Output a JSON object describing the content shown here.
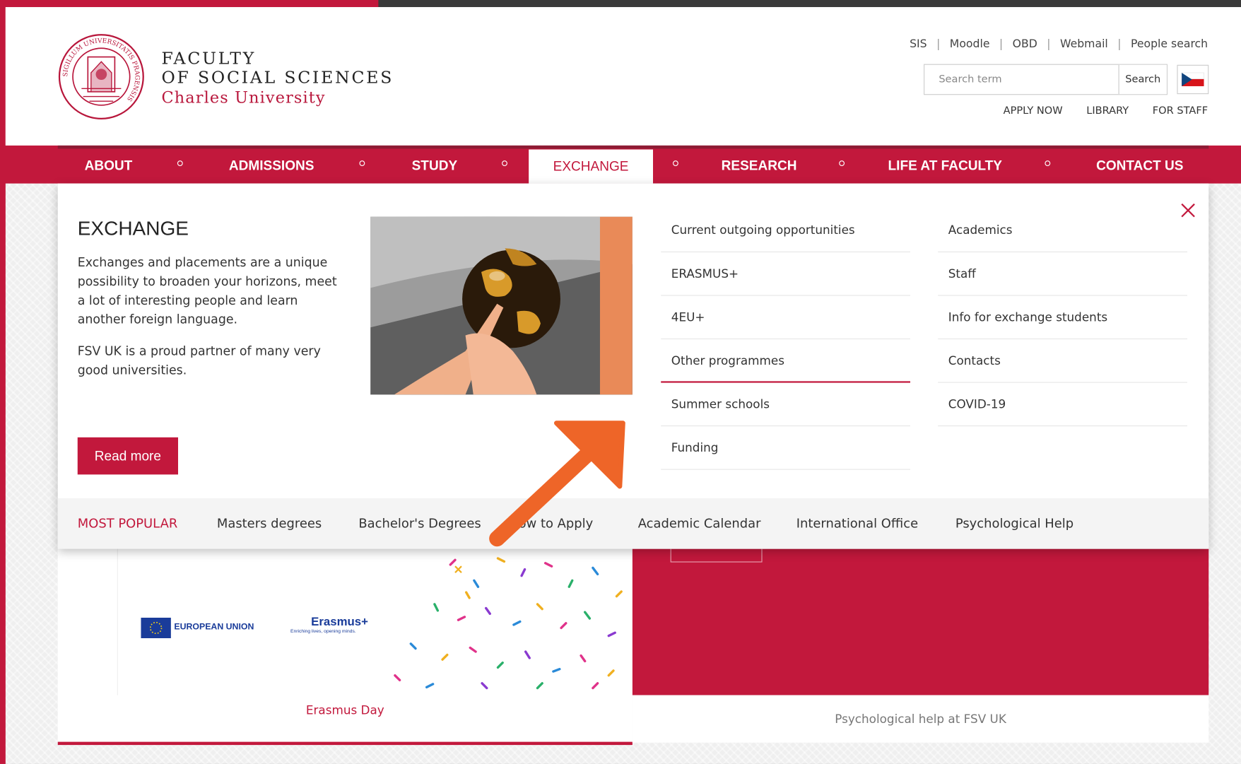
{
  "header": {
    "logo": {
      "line1": "FACULTY",
      "line2": "OF SOCIAL SCIENCES",
      "line3": "Charles University",
      "seal_text": "SIGILLUM UNIVERSITATIS PRAGENSIS"
    },
    "top_links": [
      "SIS",
      "Moodle",
      "OBD",
      "Webmail",
      "People search"
    ],
    "search": {
      "placeholder": "Search term",
      "button_label": "Search"
    },
    "language_icon": "czech-flag-icon",
    "quick_links": [
      "APPLY NOW",
      "LIBRARY",
      "FOR STAFF"
    ]
  },
  "nav": {
    "items": [
      "ABOUT",
      "ADMISSIONS",
      "STUDY",
      "EXCHANGE",
      "RESEARCH",
      "LIFE AT FACULTY",
      "CONTACT US"
    ],
    "active": "EXCHANGE"
  },
  "dropdown": {
    "title": "EXCHANGE",
    "paragraph1": "Exchanges and placements are a unique possibility to broaden your horizons, meet a lot of interesting people and learn another foreign language.",
    "paragraph2": "FSV UK is a proud partner of many very good universities.",
    "read_more": "Read more",
    "image": "globe-photo",
    "col1": [
      "Current outgoing opportunities",
      "ERASMUS+",
      "4EU+",
      "Other programmes",
      "Summer schools",
      "Funding"
    ],
    "col2": [
      "Academics",
      "Staff",
      "Info for exchange students",
      "Contacts",
      "COVID-19"
    ],
    "active_link": "Other programmes",
    "close_icon": "close-icon",
    "most_popular": {
      "label": "MOST POPULAR",
      "items": [
        "Masters degrees",
        "Bachelor's Degrees",
        "How to Apply",
        "Academic Calendar",
        "International Office",
        "Psychological Help"
      ]
    }
  },
  "cards": {
    "left": {
      "eu_label": "EUROPEAN UNION",
      "erasmus_label": "Erasmus+",
      "erasmus_tagline": "Enriching lives, opening minds.",
      "caption": "Erasmus Day"
    },
    "right": {
      "caption": "Psychological help at FSV UK"
    }
  },
  "colors": {
    "brand_red": "#c2183c",
    "arrow_orange": "#ee6528",
    "dark_bar": "#3a3a3a"
  }
}
